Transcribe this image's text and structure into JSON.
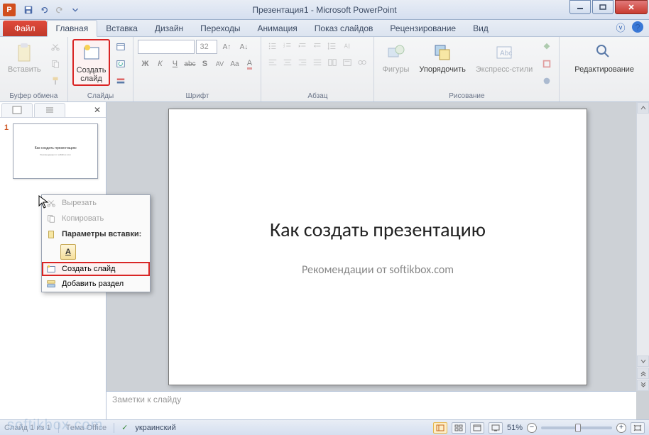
{
  "window": {
    "title": "Презентация1 - Microsoft PowerPoint",
    "app_letter": "P"
  },
  "tabs": {
    "file": "Файл",
    "items": [
      "Главная",
      "Вставка",
      "Дизайн",
      "Переходы",
      "Анимация",
      "Показ слайдов",
      "Рецензирование",
      "Вид"
    ],
    "active_index": 0
  },
  "ribbon": {
    "clipboard": {
      "label": "Буфер обмена",
      "paste": "Вставить"
    },
    "slides": {
      "label": "Слайды",
      "new_slide": "Создать\nслайд"
    },
    "font": {
      "label": "Шрифт",
      "size": "32"
    },
    "paragraph": {
      "label": "Абзац"
    },
    "drawing": {
      "label": "Рисование",
      "shapes": "Фигуры",
      "arrange": "Упорядочить",
      "quick_styles": "Экспресс-стили"
    },
    "editing": {
      "label": "",
      "edit": "Редактирование"
    }
  },
  "context_menu": {
    "cut": "Вырезать",
    "copy": "Копировать",
    "paste_options": "Параметры вставки:",
    "new_slide": "Создать слайд",
    "add_section": "Добавить раздел"
  },
  "slide": {
    "number": "1",
    "title": "Как создать презентацию",
    "subtitle": "Рекомендации от softikbox.com",
    "thumb_title": "Как создать презентацию",
    "thumb_subtitle": "Рекомендации от softikbox.com"
  },
  "notes": {
    "placeholder": "Заметки к слайду"
  },
  "status": {
    "slide_info": "Слайд 1 из 1",
    "theme": "Тема Office",
    "language": "украинский",
    "zoom": "51%"
  },
  "watermark": "softikbox.com"
}
